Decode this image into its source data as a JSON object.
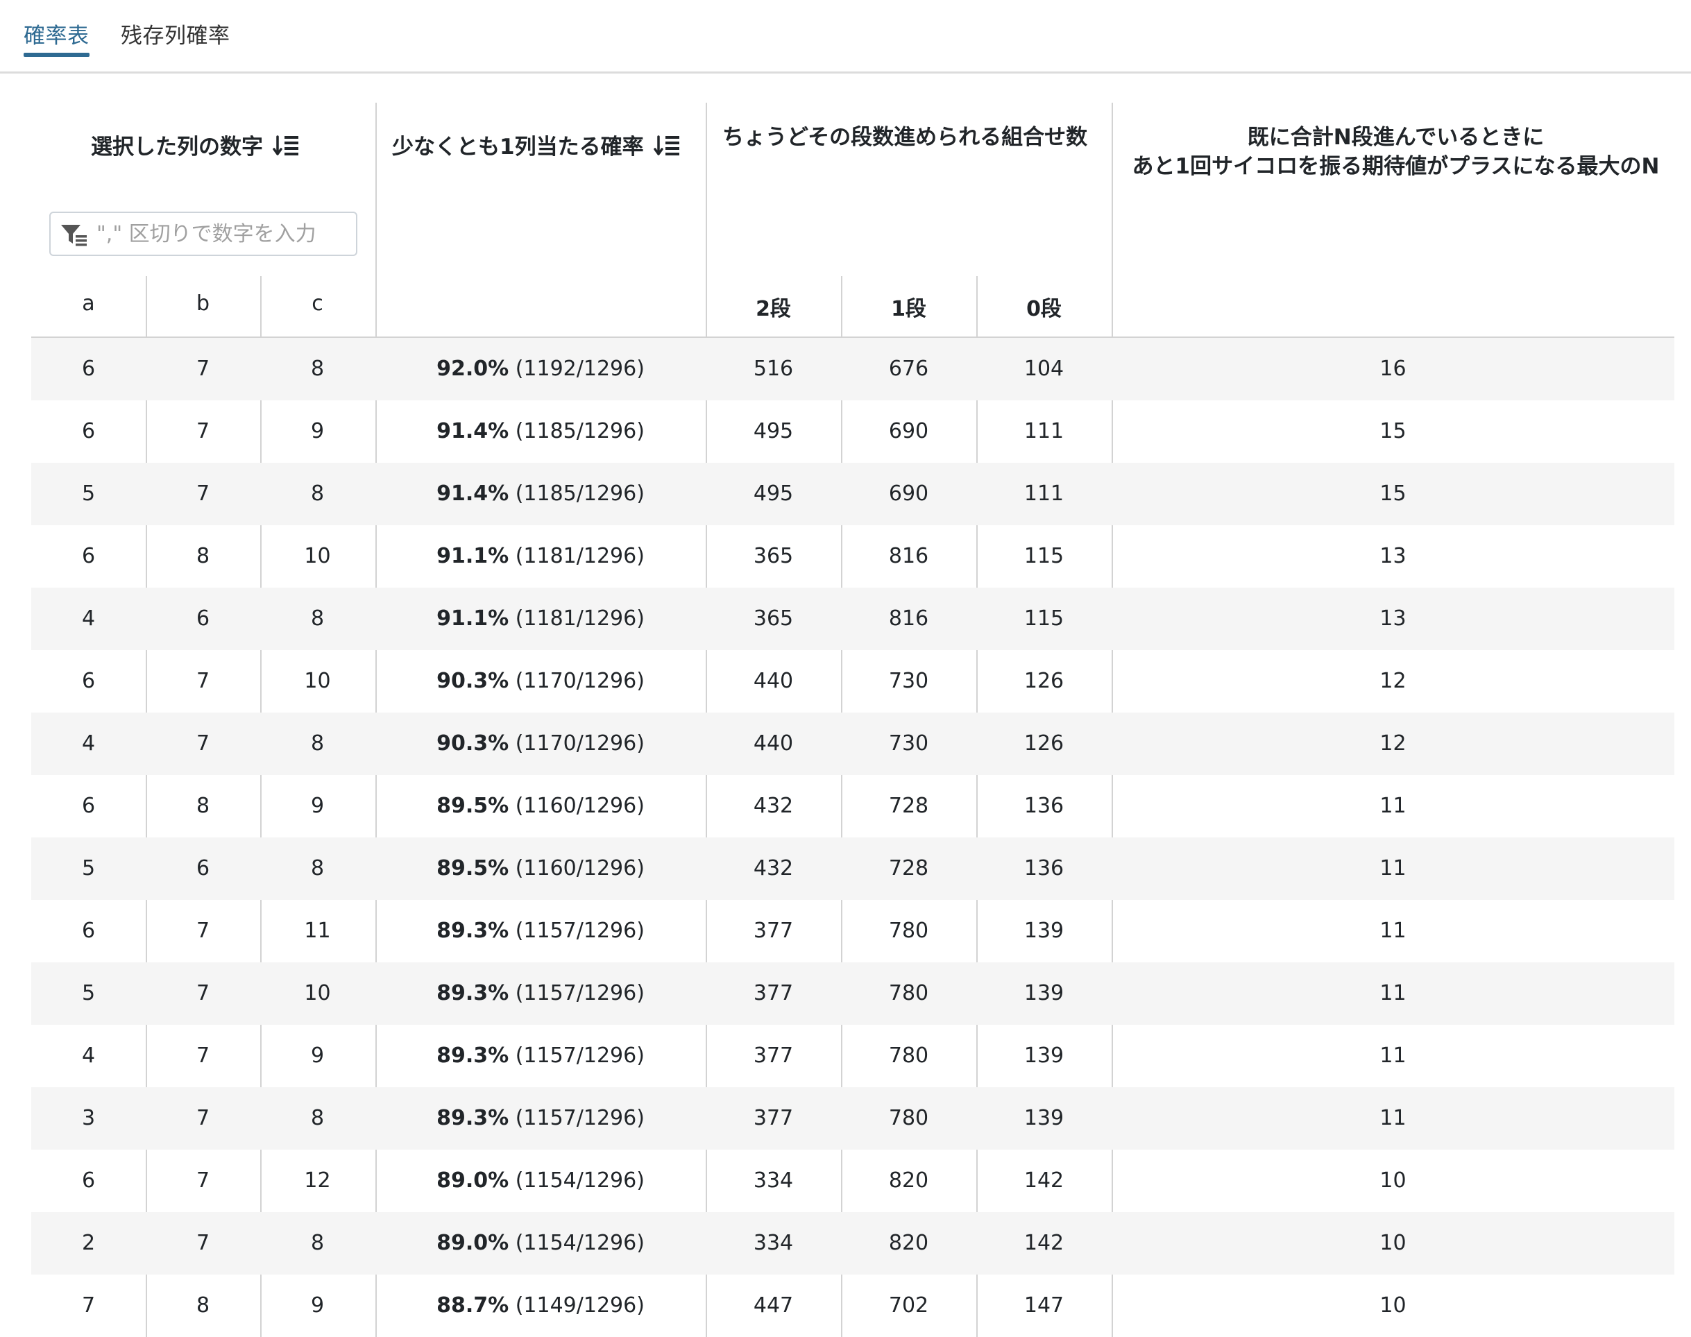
{
  "tabs": [
    {
      "label": "確率表",
      "active": true
    },
    {
      "label": "残存列確率",
      "active": false
    }
  ],
  "table": {
    "headers": {
      "selected_columns": "選択した列の数字",
      "probability": "少なくとも1列当たる確率",
      "combinations": "ちょうどその段数進められる組合せ数",
      "max_n_line1": "既に合計N段進んでいるときに",
      "max_n_line2": "あと1回サイコロを振る期待値がプラスになる最大のN"
    },
    "filter_placeholder": "\",\" 区切りで数字を入力",
    "subheaders": {
      "a": "a",
      "b": "b",
      "c": "c",
      "two": "2段",
      "one": "1段",
      "zero": "0段"
    },
    "rows": [
      {
        "a": "6",
        "b": "7",
        "c": "8",
        "pct": "92.0%",
        "frac": "(1192/1296)",
        "s2": "516",
        "s1": "676",
        "s0": "104",
        "n": "16"
      },
      {
        "a": "6",
        "b": "7",
        "c": "9",
        "pct": "91.4%",
        "frac": "(1185/1296)",
        "s2": "495",
        "s1": "690",
        "s0": "111",
        "n": "15"
      },
      {
        "a": "5",
        "b": "7",
        "c": "8",
        "pct": "91.4%",
        "frac": "(1185/1296)",
        "s2": "495",
        "s1": "690",
        "s0": "111",
        "n": "15"
      },
      {
        "a": "6",
        "b": "8",
        "c": "10",
        "pct": "91.1%",
        "frac": "(1181/1296)",
        "s2": "365",
        "s1": "816",
        "s0": "115",
        "n": "13"
      },
      {
        "a": "4",
        "b": "6",
        "c": "8",
        "pct": "91.1%",
        "frac": "(1181/1296)",
        "s2": "365",
        "s1": "816",
        "s0": "115",
        "n": "13"
      },
      {
        "a": "6",
        "b": "7",
        "c": "10",
        "pct": "90.3%",
        "frac": "(1170/1296)",
        "s2": "440",
        "s1": "730",
        "s0": "126",
        "n": "12"
      },
      {
        "a": "4",
        "b": "7",
        "c": "8",
        "pct": "90.3%",
        "frac": "(1170/1296)",
        "s2": "440",
        "s1": "730",
        "s0": "126",
        "n": "12"
      },
      {
        "a": "6",
        "b": "8",
        "c": "9",
        "pct": "89.5%",
        "frac": "(1160/1296)",
        "s2": "432",
        "s1": "728",
        "s0": "136",
        "n": "11"
      },
      {
        "a": "5",
        "b": "6",
        "c": "8",
        "pct": "89.5%",
        "frac": "(1160/1296)",
        "s2": "432",
        "s1": "728",
        "s0": "136",
        "n": "11"
      },
      {
        "a": "6",
        "b": "7",
        "c": "11",
        "pct": "89.3%",
        "frac": "(1157/1296)",
        "s2": "377",
        "s1": "780",
        "s0": "139",
        "n": "11"
      },
      {
        "a": "5",
        "b": "7",
        "c": "10",
        "pct": "89.3%",
        "frac": "(1157/1296)",
        "s2": "377",
        "s1": "780",
        "s0": "139",
        "n": "11"
      },
      {
        "a": "4",
        "b": "7",
        "c": "9",
        "pct": "89.3%",
        "frac": "(1157/1296)",
        "s2": "377",
        "s1": "780",
        "s0": "139",
        "n": "11"
      },
      {
        "a": "3",
        "b": "7",
        "c": "8",
        "pct": "89.3%",
        "frac": "(1157/1296)",
        "s2": "377",
        "s1": "780",
        "s0": "139",
        "n": "11"
      },
      {
        "a": "6",
        "b": "7",
        "c": "12",
        "pct": "89.0%",
        "frac": "(1154/1296)",
        "s2": "334",
        "s1": "820",
        "s0": "142",
        "n": "10"
      },
      {
        "a": "2",
        "b": "7",
        "c": "8",
        "pct": "89.0%",
        "frac": "(1154/1296)",
        "s2": "334",
        "s1": "820",
        "s0": "142",
        "n": "10"
      },
      {
        "a": "7",
        "b": "8",
        "c": "9",
        "pct": "88.7%",
        "frac": "(1149/1296)",
        "s2": "447",
        "s1": "702",
        "s0": "147",
        "n": "10"
      }
    ]
  },
  "colors": {
    "accent": "#2e6a92",
    "stripe": "#f5f5f5",
    "border": "#d3d3d3"
  }
}
